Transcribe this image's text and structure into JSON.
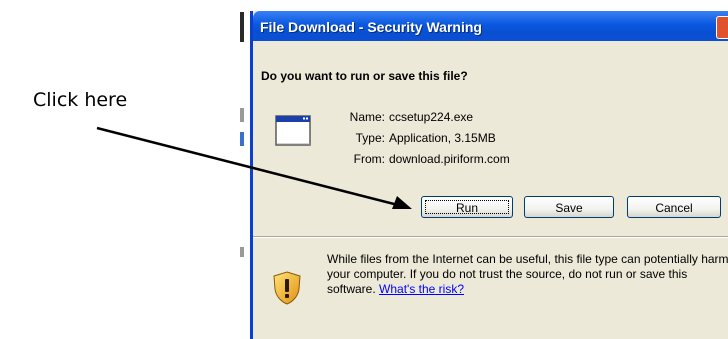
{
  "annotation": {
    "text": "Click here"
  },
  "dialog": {
    "title": "File Download - Security Warning",
    "question": "Do you want to run or save this file?",
    "file": {
      "name_label": "Name:",
      "name_value": "ccsetup224.exe",
      "type_label": "Type:",
      "type_value": "Application, 3.15MB",
      "from_label": "From:",
      "from_value": "download.piriform.com"
    },
    "buttons": {
      "run": "Run",
      "save": "Save",
      "cancel": "Cancel"
    },
    "warning": {
      "text": "While files from the Internet can be useful, this file type can potentially harm your computer. If you do not trust the source, do not run or save this software. ",
      "link": "What's the risk?"
    },
    "colors": {
      "titlebar": "#0a58e0",
      "body": "#ece9d8",
      "link": "#0000ff"
    }
  }
}
